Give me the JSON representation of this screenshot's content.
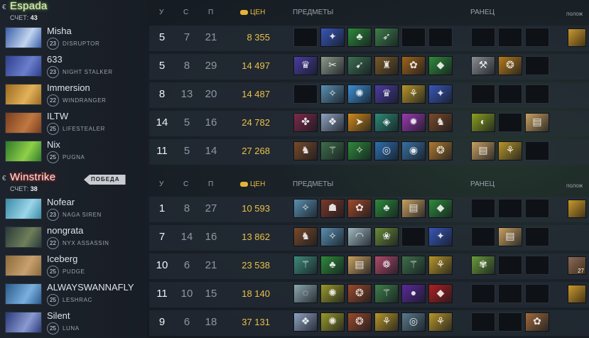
{
  "columns": {
    "kills": "У",
    "deaths": "С",
    "assists": "П",
    "networth": "ЦЕН",
    "items": "ПРЕДМЕТЫ",
    "backpack": "РАНЕЦ",
    "neutral": "полож"
  },
  "score_prefix": "СЧЕТ:",
  "radiant": {
    "name": "Espada",
    "score": "43",
    "players": [
      {
        "name": "Misha",
        "level": "23",
        "hero": "DISRUPTOR",
        "k": "5",
        "d": "7",
        "a": "21",
        "nw": "8 355",
        "portrait": [
          "#3a5fa8",
          "#c2d4ef"
        ],
        "items": [
          null,
          {
            "c": "#3857b8",
            "g": "✦"
          },
          {
            "c": "#2e8a3b",
            "g": "♣"
          },
          {
            "c": "#3f7f4a",
            "g": "➶"
          },
          null,
          null
        ],
        "backpack": [
          null,
          null,
          null
        ],
        "neutral": {
          "c": "#c99a2e",
          "count": ""
        }
      },
      {
        "name": "633",
        "level": "23",
        "hero": "NIGHT STALKER",
        "k": "5",
        "d": "8",
        "a": "29",
        "nw": "14 497",
        "portrait": [
          "#2f3f8c",
          "#6a7fcc"
        ],
        "items": [
          {
            "c": "#4b3da0",
            "g": "♛"
          },
          {
            "c": "#8c9a8a",
            "g": "✂"
          },
          {
            "c": "#3d6f52",
            "g": "➹"
          },
          {
            "c": "#7a5a2a",
            "g": "♜"
          },
          {
            "c": "#a0641c",
            "g": "✿"
          },
          {
            "c": "#2f8a3a",
            "g": "◆"
          }
        ],
        "backpack": [
          {
            "c": "#8a8e93",
            "g": "⚒"
          },
          {
            "c": "#b57b1c",
            "g": "❂"
          },
          null
        ],
        "neutral": null
      },
      {
        "name": "Immersion",
        "level": "22",
        "hero": "WINDRANGER",
        "k": "8",
        "d": "13",
        "a": "20",
        "nw": "14 487",
        "portrait": [
          "#9c6a1f",
          "#e2b25a"
        ],
        "items": [
          null,
          {
            "c": "#5a8fb0",
            "g": "✧"
          },
          {
            "c": "#3d8fd0",
            "g": "✺"
          },
          {
            "c": "#4b3da0",
            "g": "♛"
          },
          {
            "c": "#b8962a",
            "g": "⚘"
          },
          {
            "c": "#3857b8",
            "g": "✦"
          }
        ],
        "backpack": [
          null,
          null,
          null
        ],
        "neutral": null
      },
      {
        "name": "ILTW",
        "level": "25",
        "hero": "LIFESTEALER",
        "k": "14",
        "d": "5",
        "a": "16",
        "nw": "24 782",
        "portrait": [
          "#7a3e1e",
          "#c07840"
        ],
        "items": [
          {
            "c": "#7b2b4a",
            "g": "✤"
          },
          {
            "c": "#8fa2c0",
            "g": "❖"
          },
          {
            "c": "#d08a1a",
            "g": "➤"
          },
          {
            "c": "#2e8a76",
            "g": "◈"
          },
          {
            "c": "#9a3ab0",
            "g": "✹"
          },
          {
            "c": "#7a4a2a",
            "g": "♞"
          }
        ],
        "backpack": [
          {
            "c": "#8aa020",
            "g": "◐"
          },
          null,
          {
            "c": "#c8a060",
            "g": "▤"
          }
        ],
        "neutral": null
      },
      {
        "name": "Nix",
        "level": "25",
        "hero": "PUGNA",
        "k": "11",
        "d": "5",
        "a": "14",
        "nw": "27 268",
        "portrait": [
          "#2f7a2a",
          "#8fd048"
        ],
        "items": [
          {
            "c": "#7a4a2a",
            "g": "♞"
          },
          {
            "c": "#3f6f4a",
            "g": "⚚"
          },
          {
            "c": "#2f8a3a",
            "g": "✧"
          },
          {
            "c": "#2f6fb0",
            "g": "◎"
          },
          {
            "c": "#3a70a0",
            "g": "◉"
          },
          {
            "c": "#b07a30",
            "g": "❂"
          }
        ],
        "backpack": [
          {
            "c": "#c8a060",
            "g": "▤"
          },
          {
            "c": "#b8962a",
            "g": "⚘"
          },
          null
        ],
        "neutral": null,
        "extra_item": {
          "c": "#b03020",
          "g": "➶"
        }
      }
    ]
  },
  "dire": {
    "name": "Winstrike",
    "score": "38",
    "badge": "ПОБЕДА",
    "players": [
      {
        "name": "Nofear",
        "level": "23",
        "hero": "NAGA SIREN",
        "k": "1",
        "d": "8",
        "a": "27",
        "nw": "10 593",
        "portrait": [
          "#3a8aa8",
          "#9ad6e8"
        ],
        "items": [
          {
            "c": "#5a8fb0",
            "g": "✧"
          },
          {
            "c": "#7a3a2a",
            "g": "☗"
          },
          {
            "c": "#a04a2a",
            "g": "✿"
          },
          {
            "c": "#2e8a3b",
            "g": "♣"
          },
          {
            "c": "#c8a060",
            "g": "▤"
          },
          {
            "c": "#2f8a3a",
            "g": "◆"
          }
        ],
        "backpack": [
          null,
          null,
          null
        ],
        "neutral": {
          "c": "#c99a2e",
          "count": ""
        }
      },
      {
        "name": "nongrata",
        "level": "22",
        "hero": "NYX ASSASSIN",
        "k": "7",
        "d": "14",
        "a": "16",
        "nw": "13 862",
        "portrait": [
          "#2a3a3a",
          "#6f7f5a"
        ],
        "items": [
          {
            "c": "#7a4a2a",
            "g": "♞"
          },
          {
            "c": "#5a8fb0",
            "g": "✧"
          },
          {
            "c": "#a0b8c0",
            "g": "◠"
          },
          {
            "c": "#6a8a3a",
            "g": "❀"
          },
          null,
          {
            "c": "#3857b8",
            "g": "✦"
          }
        ],
        "backpack": [
          null,
          {
            "c": "#c8a060",
            "g": "▤"
          },
          null
        ],
        "neutral": null
      },
      {
        "name": "Iceberg",
        "level": "25",
        "hero": "PUDGE",
        "k": "10",
        "d": "6",
        "a": "21",
        "nw": "23 538",
        "portrait": [
          "#8a6a3a",
          "#c8a070"
        ],
        "items": [
          {
            "c": "#3f8a7a",
            "g": "⚚"
          },
          {
            "c": "#2e8a3b",
            "g": "♣"
          },
          {
            "c": "#c8a060",
            "g": "▤"
          },
          {
            "c": "#b04a6a",
            "g": "❁"
          },
          {
            "c": "#3f6f4a",
            "g": "⚚"
          },
          {
            "c": "#b8962a",
            "g": "⚘"
          }
        ],
        "backpack": [
          {
            "c": "#6a9a3a",
            "g": "✾"
          },
          null,
          null
        ],
        "neutral": {
          "c": "#8a6a5a",
          "count": "27"
        }
      },
      {
        "name": "ALWAYSWANNAFLY",
        "level": "25",
        "hero": "LESHRAC",
        "k": "11",
        "d": "10",
        "a": "15",
        "nw": "18 140",
        "portrait": [
          "#2a5a8a",
          "#7ab0e0"
        ],
        "items": [
          {
            "c": "#8fa8b0",
            "g": "◌"
          },
          {
            "c": "#9a9a2a",
            "g": "✺"
          },
          {
            "c": "#9a4a2a",
            "g": "❂"
          },
          {
            "c": "#3f7f4a",
            "g": "⚚"
          },
          {
            "c": "#5a2a9a",
            "g": "●"
          },
          {
            "c": "#b02020",
            "g": "◆"
          }
        ],
        "backpack": [
          null,
          null,
          null
        ],
        "neutral": {
          "c": "#c99a2e",
          "count": ""
        }
      },
      {
        "name": "Silent",
        "level": "25",
        "hero": "LUNA",
        "k": "9",
        "d": "6",
        "a": "18",
        "nw": "37 131",
        "portrait": [
          "#2a3a7a",
          "#8a9ad0"
        ],
        "items": [
          {
            "c": "#8fa2c0",
            "g": "❖"
          },
          {
            "c": "#9a9a2a",
            "g": "✺"
          },
          {
            "c": "#9a4a2a",
            "g": "❂"
          },
          {
            "c": "#b8962a",
            "g": "⚘"
          },
          {
            "c": "#5a7a8a",
            "g": "◎"
          },
          {
            "c": "#b8962a",
            "g": "⚘"
          }
        ],
        "backpack": [
          null,
          null,
          {
            "c": "#a06a3a",
            "g": "✿"
          }
        ],
        "neutral": null
      }
    ]
  }
}
